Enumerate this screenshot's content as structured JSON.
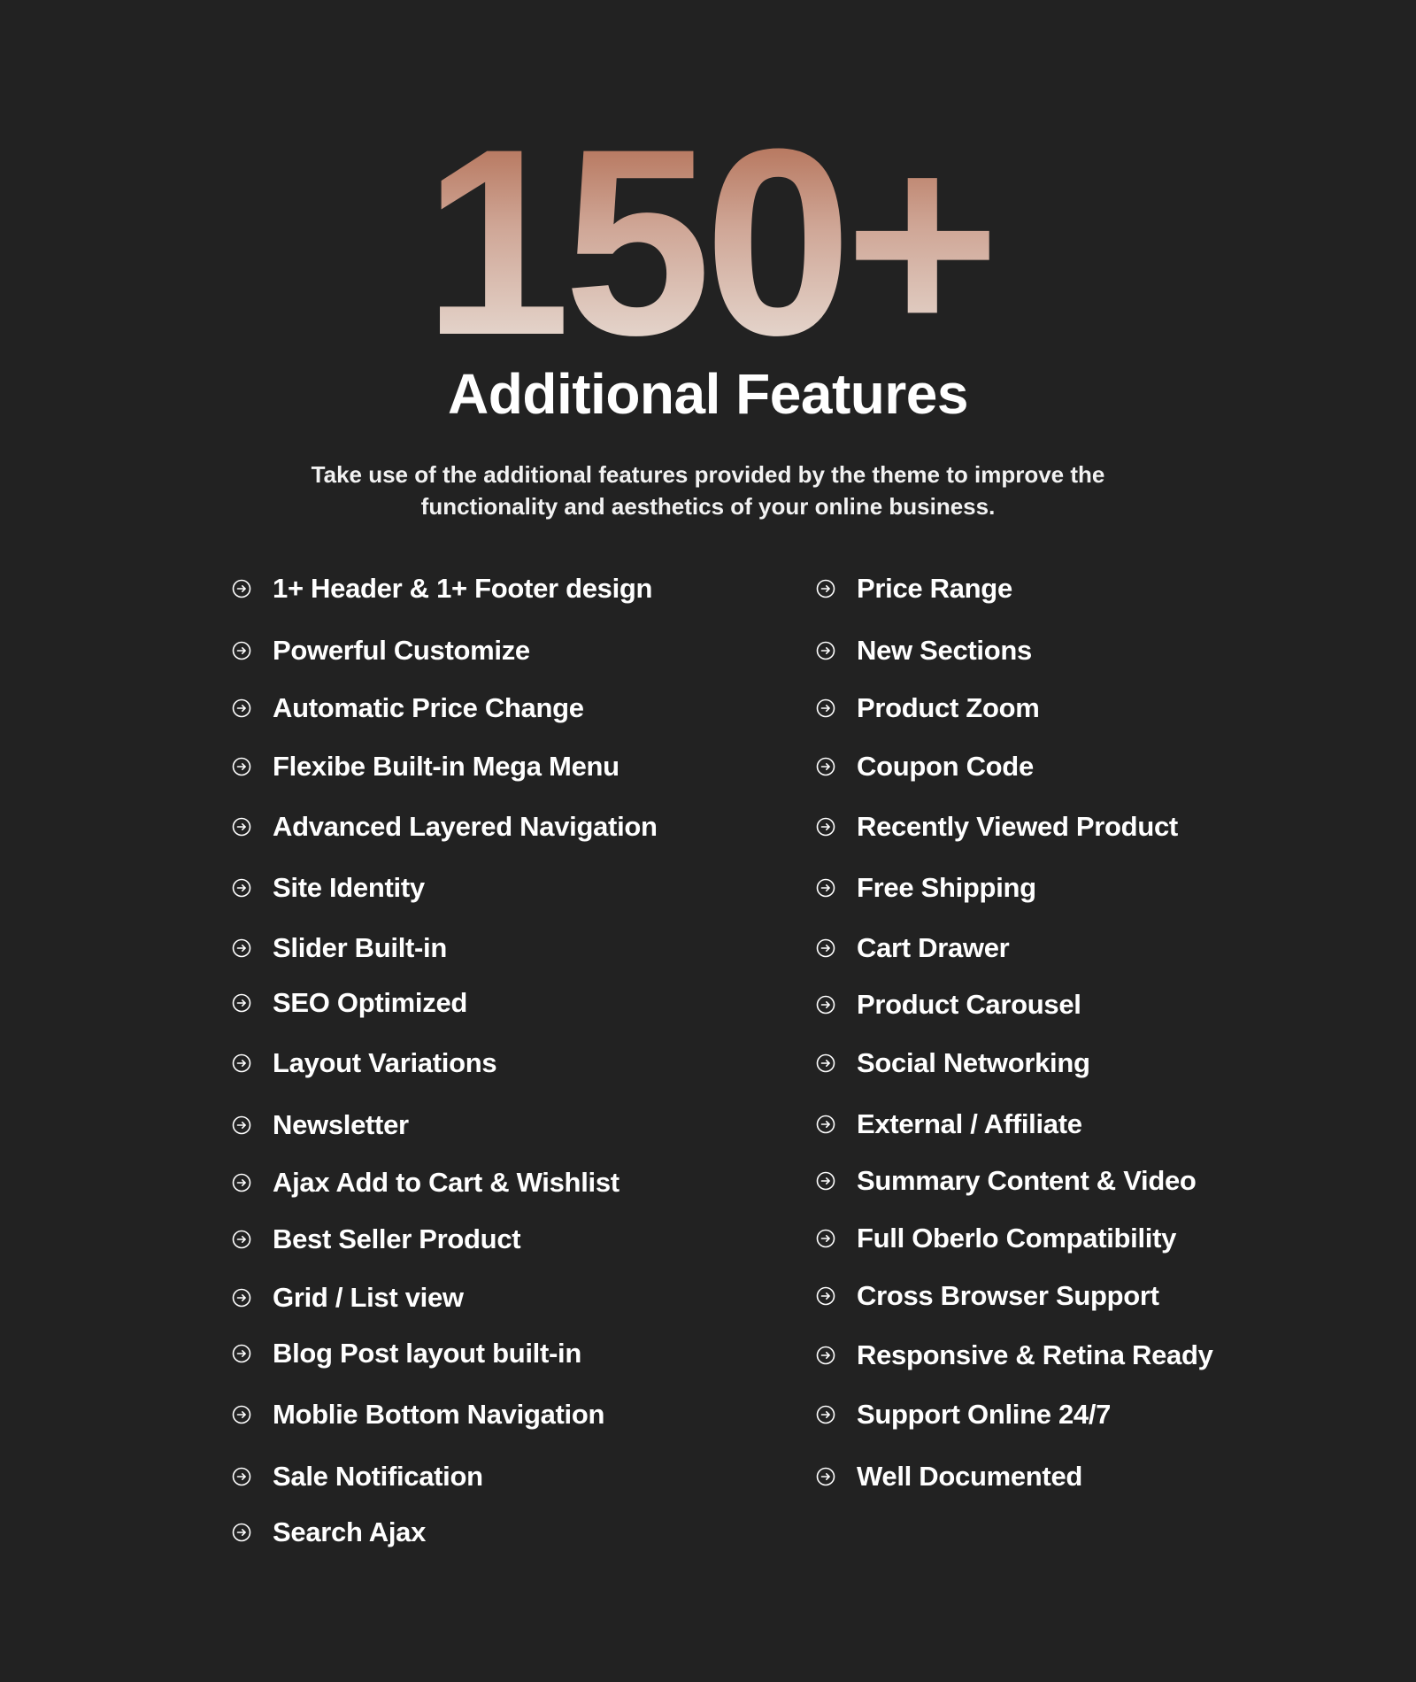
{
  "hero": {
    "big_number": "150+",
    "gradient_top": "#a85a3c",
    "gradient_bottom": "#eeeae4"
  },
  "heading": "Additional Features",
  "description": "Take use of the additional features provided by the theme to improve the functionality and aesthetics of your online business.",
  "colors": {
    "background": "#222222",
    "text": "#ffffff"
  },
  "icon": "circle-arrow-right-icon",
  "features_left": [
    "1+ Header & 1+ Footer design",
    "Powerful Customize",
    "Automatic Price Change",
    "Flexibe Built-in Mega Menu",
    "Advanced Layered Navigation",
    "Site Identity",
    "Slider Built-in",
    "SEO Optimized",
    "Layout Variations",
    "Newsletter",
    "Ajax Add to Cart & Wishlist",
    "Best Seller Product",
    "Grid / List view",
    "Blog Post layout built-in",
    "Moblie Bottom Navigation",
    "Sale Notification",
    "Search Ajax"
  ],
  "features_right": [
    "Price Range",
    "New Sections",
    "Product Zoom",
    "Coupon Code",
    "Recently Viewed Product",
    "Free Shipping",
    "Cart Drawer",
    "Product Carousel",
    "Social Networking",
    "External / Affiliate",
    "Summary Content & Video",
    "Full Oberlo Compatibility",
    "Cross Browser Support",
    "Responsive & Retina Ready",
    "Support Online 24/7",
    "Well Documented"
  ]
}
